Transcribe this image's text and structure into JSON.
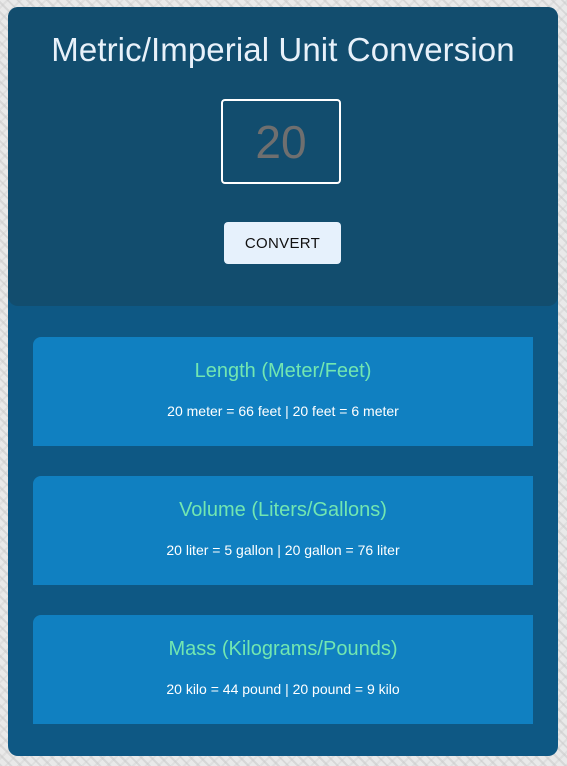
{
  "header": {
    "title": "Metric/Imperial Unit Conversion",
    "input_value": "20",
    "convert_label": "CONVERT"
  },
  "cards": [
    {
      "title": "Length (Meter/Feet)",
      "result": "20 meter = 66 feet | 20 feet = 6 meter"
    },
    {
      "title": "Volume (Liters/Gallons)",
      "result": "20 liter = 5 gallon | 20 gallon = 76 liter"
    },
    {
      "title": "Mass (Kilograms/Pounds)",
      "result": "20 kilo = 44 pound | 20 pound = 9 kilo"
    }
  ],
  "colors": {
    "app_background": "#0e5884",
    "header_background": "#124d6e",
    "card_background": "#1080c1",
    "card_title": "#72e6b1",
    "button_background": "#e6f1fc"
  }
}
